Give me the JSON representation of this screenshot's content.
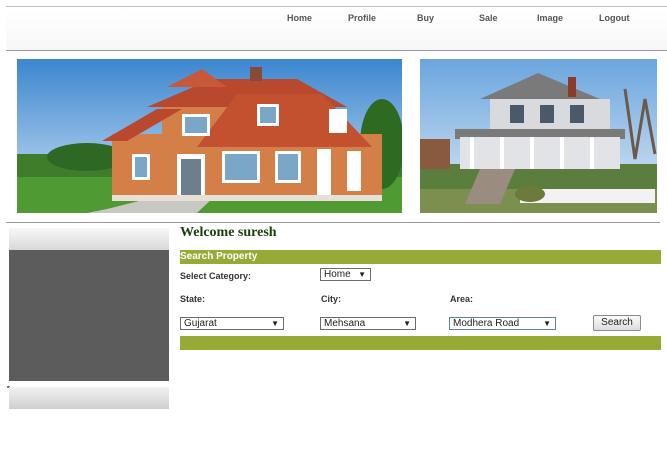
{
  "nav": {
    "items": [
      {
        "label": "Home"
      },
      {
        "label": "Profile"
      },
      {
        "label": "Buy"
      },
      {
        "label": "Sale"
      },
      {
        "label": "Image"
      },
      {
        "label": "Logout"
      }
    ]
  },
  "welcome": "Welcome suresh",
  "search": {
    "title": "Search Property",
    "category_label": "Select Category:",
    "category_value": "Home",
    "state_label": "State:",
    "city_label": "City:",
    "area_label": "Area:",
    "state_value": "Gujarat",
    "city_value": "Mehsana",
    "area_value": "Modhera Road",
    "button": "Search"
  },
  "colors": {
    "accent": "#97aa36",
    "welcome": "#1a3d0c",
    "side_panel": "#5c5c5c"
  }
}
